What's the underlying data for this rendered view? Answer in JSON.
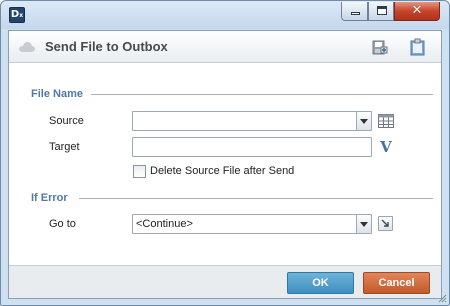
{
  "window": {
    "app_icon_letter": "D",
    "app_icon_sub": "x",
    "controls": {
      "minimize": "minimize",
      "maximize": "maximize",
      "close_glyph": "✕"
    }
  },
  "header": {
    "title": "Send File to Outbox",
    "icons": [
      "cloud-icon",
      "save-icon",
      "clipboard-icon"
    ]
  },
  "file_name_section": {
    "label": "File Name",
    "source_label": "Source",
    "source_value": "",
    "target_label": "Target",
    "target_value": "",
    "variable_button": "V",
    "delete_checkbox_label": "Delete Source File after Send",
    "delete_checked": false
  },
  "if_error_section": {
    "label": "If Error",
    "goto_label": "Go to",
    "goto_value": "<Continue>"
  },
  "footer": {
    "ok_label": "OK",
    "cancel_label": "Cancel"
  },
  "colors": {
    "section_label": "#5377a7",
    "ok_button": "#4a9ccb",
    "cancel_button": "#d06a3c",
    "window_frame": "#cfe0f1"
  }
}
